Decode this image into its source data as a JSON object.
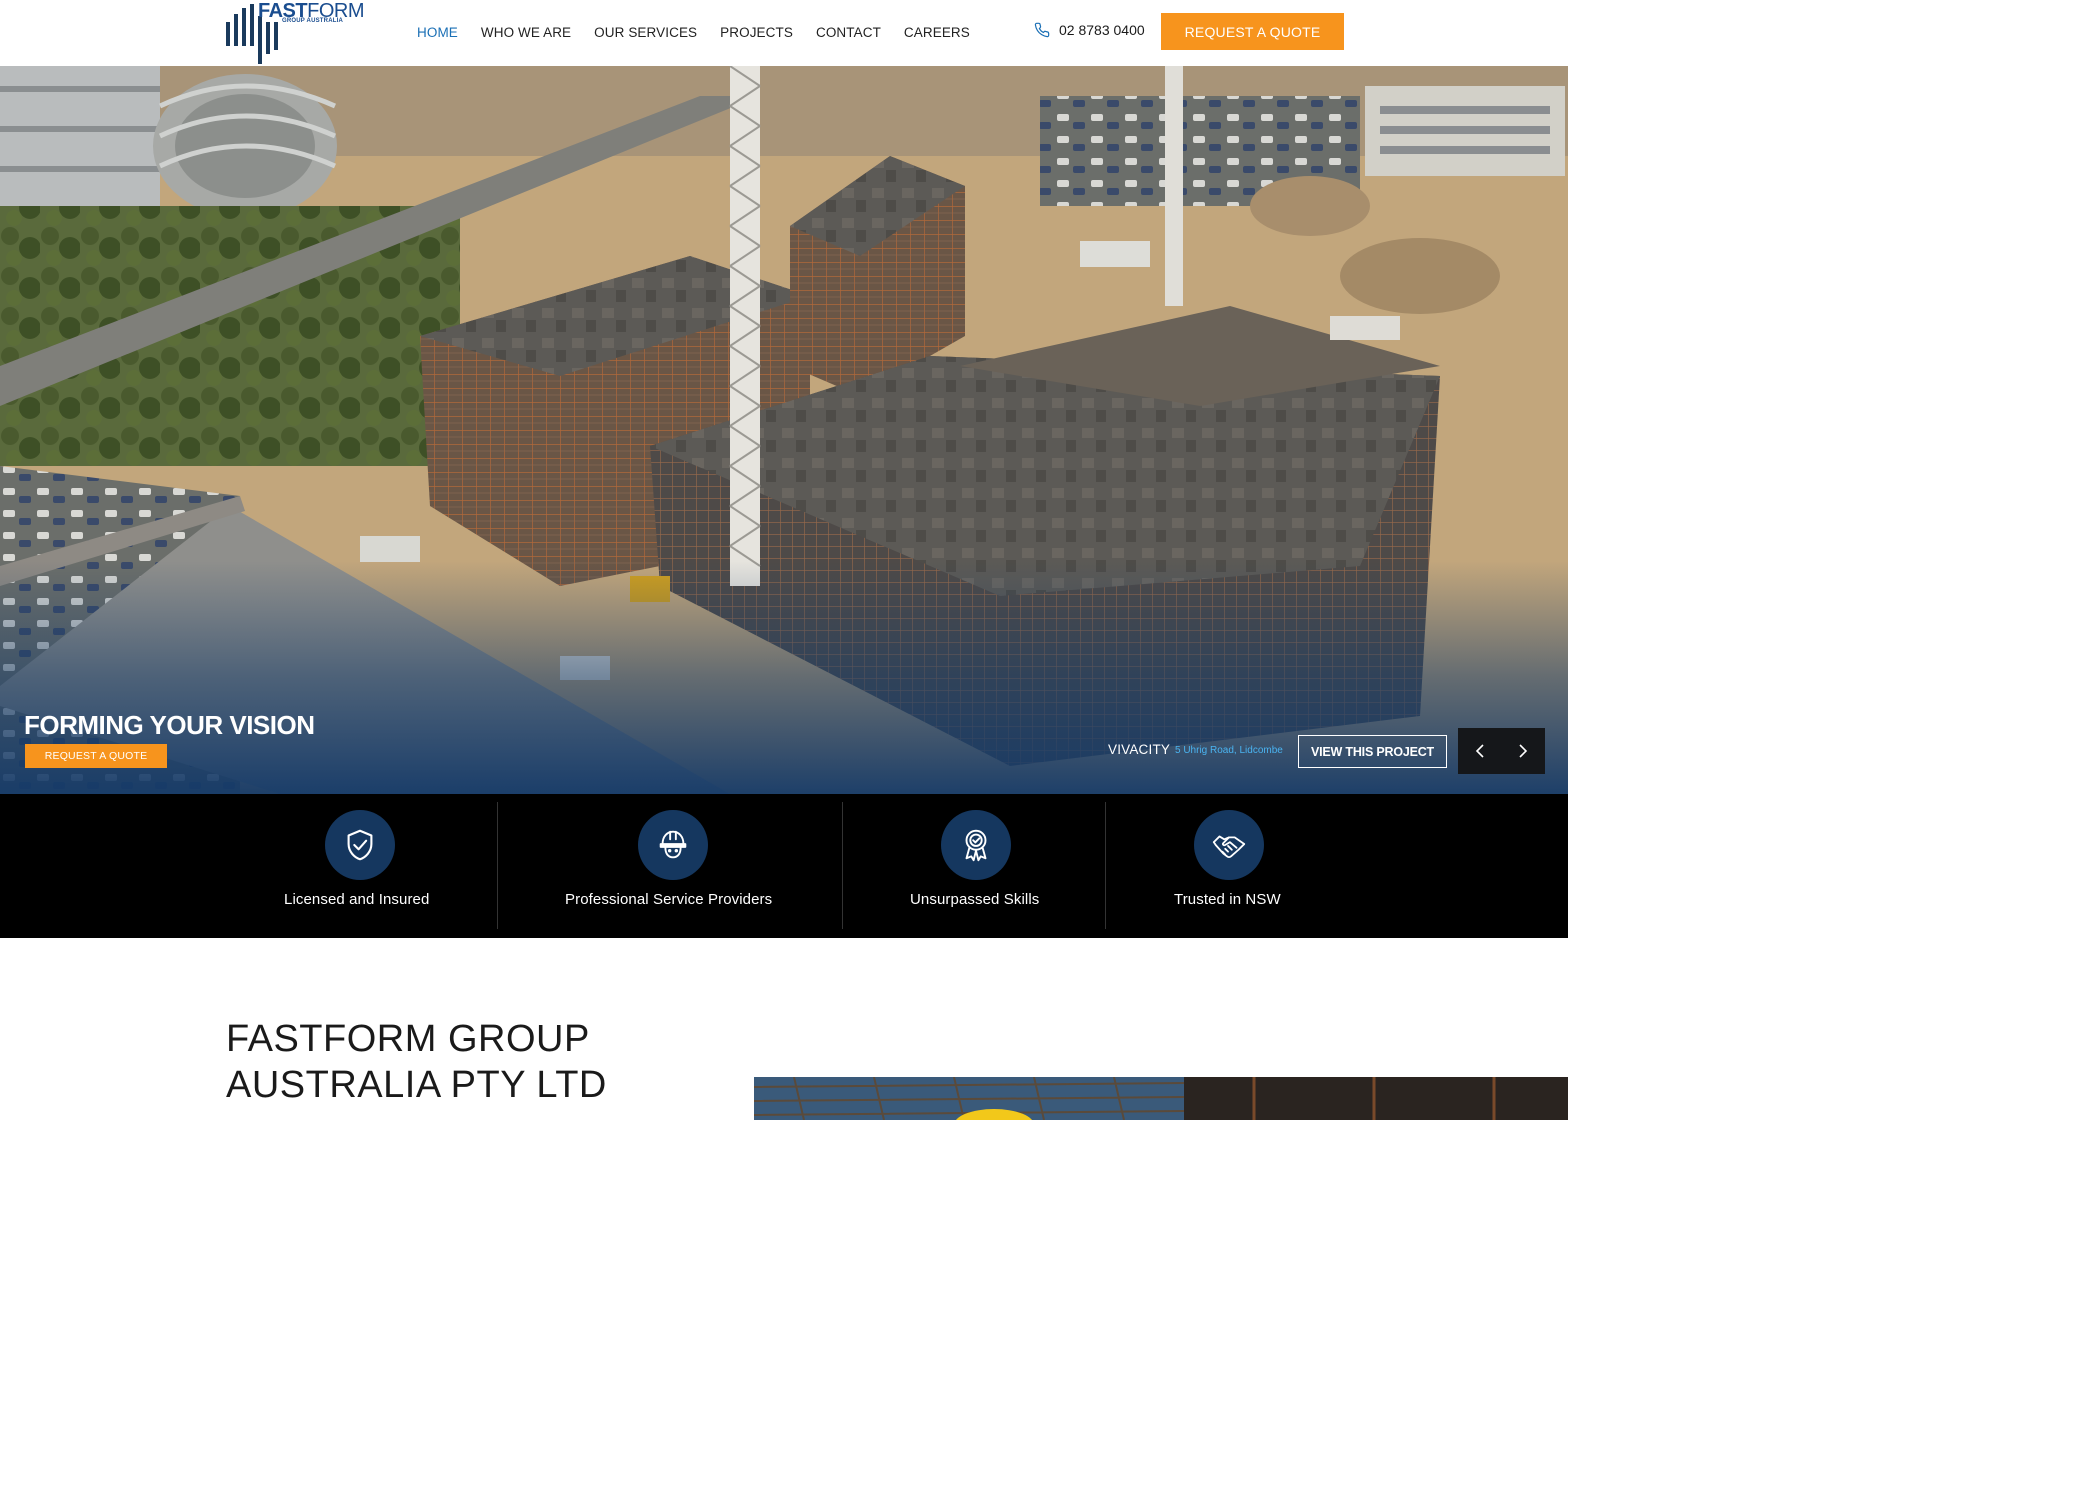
{
  "brand": {
    "logo_main": "FASTFORM",
    "logo_bold": "FAST",
    "logo_light": "FORM",
    "logo_sub": "GROUP AUSTRALIA"
  },
  "nav": {
    "items": [
      {
        "label": "HOME",
        "active": true
      },
      {
        "label": "WHO WE ARE",
        "active": false
      },
      {
        "label": "OUR SERVICES",
        "active": false
      },
      {
        "label": "PROJECTS",
        "active": false
      },
      {
        "label": "CONTACT",
        "active": false
      },
      {
        "label": "CAREERS",
        "active": false
      }
    ]
  },
  "header": {
    "phone": "02 8783 0400",
    "quote_label": "REQUEST A QUOTE"
  },
  "hero": {
    "title": "FORMING YOUR VISION",
    "quote_label": "REQUEST A QUOTE",
    "project_name": "VIVACITY",
    "project_address": "5 Uhrig Road, Lidcombe",
    "view_label": "VIEW THIS PROJECT",
    "prev_icon": "chevron-left-icon",
    "next_icon": "chevron-right-icon"
  },
  "features": [
    {
      "label": "Licensed and Insured",
      "icon": "shield-check-icon"
    },
    {
      "label": "Professional Service Providers",
      "icon": "hard-hat-worker-icon"
    },
    {
      "label": "Unsurpassed Skills",
      "icon": "award-ribbon-icon"
    },
    {
      "label": "Trusted in NSW",
      "icon": "handshake-icon"
    }
  ],
  "about": {
    "title_line1": "FASTFORM GROUP",
    "title_line2": "AUSTRALIA PTY LTD"
  },
  "colors": {
    "accent_orange": "#f7941d",
    "brand_blue": "#1a4d8f",
    "nav_active": "#1a6fb5",
    "feature_circle": "#15375f",
    "features_bg": "#000000",
    "hero_overlay": "#173c68",
    "project_addr": "#4ab3f0"
  }
}
